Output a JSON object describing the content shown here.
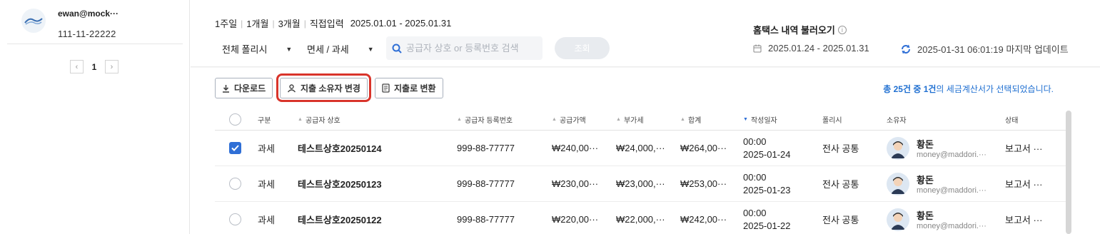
{
  "sidebar": {
    "account_email": "ewan@mock···",
    "business_number": "111-11-22222",
    "pager": {
      "current": "1",
      "prev_icon": "chevron-left-icon",
      "next_icon": "chevron-right-icon"
    }
  },
  "filters": {
    "periods": [
      "1주일",
      "1개월",
      "3개월",
      "직접입력"
    ],
    "date_range": "2025.01.01 - 2025.01.31",
    "policy_select": "전체 폴리시",
    "tax_select": "면세 / 과세",
    "search_placeholder": "공급자 상호 or 등록번호 검색",
    "inquiry_button": "조회"
  },
  "hometax": {
    "title": "홈택스 내역 불러오기",
    "range": "2025.01.24 - 2025.01.31",
    "last_update": "2025-01-31 06:01:19 마지막 업데이트"
  },
  "toolbar": {
    "download": "다운로드",
    "change_owner": "지출 소유자 변경",
    "convert": "지출로 변환",
    "summary_prefix": "총 25건 중 1건",
    "summary_suffix": "의 세금계산서가 선택되었습니다."
  },
  "table": {
    "headers": {
      "type": "구분",
      "supplier": "공급자 상호",
      "biz_no": "공급자 등록번호",
      "supply": "공급가액",
      "vat": "부가세",
      "total": "합계",
      "date": "작성일자",
      "policy": "폴리시",
      "owner": "소유자",
      "status": "상태"
    },
    "rows": [
      {
        "checked": true,
        "type": "과세",
        "supplier": "테스트상호20250124",
        "biz_no": "999-88-77777",
        "supply": "₩240,00···",
        "vat": "₩24,000,···",
        "total": "₩264,00···",
        "time": "00:00",
        "date": "2025-01-24",
        "policy": "전사 공통",
        "owner_name": "황돈",
        "owner_mail": "money@maddori.···",
        "status": "보고서 ···"
      },
      {
        "checked": false,
        "type": "과세",
        "supplier": "테스트상호20250123",
        "biz_no": "999-88-77777",
        "supply": "₩230,00···",
        "vat": "₩23,000,···",
        "total": "₩253,00···",
        "time": "00:00",
        "date": "2025-01-23",
        "policy": "전사 공통",
        "owner_name": "황돈",
        "owner_mail": "money@maddori.···",
        "status": "보고서 ···"
      },
      {
        "checked": false,
        "type": "과세",
        "supplier": "테스트상호20250122",
        "biz_no": "999-88-77777",
        "supply": "₩220,00···",
        "vat": "₩22,000,···",
        "total": "₩242,00···",
        "time": "00:00",
        "date": "2025-01-22",
        "policy": "전사 공통",
        "owner_name": "황돈",
        "owner_mail": "money@maddori.···",
        "status": "보고서 ···"
      }
    ]
  },
  "colors": {
    "accent": "#2f6fd6",
    "highlight": "#d9342b"
  }
}
